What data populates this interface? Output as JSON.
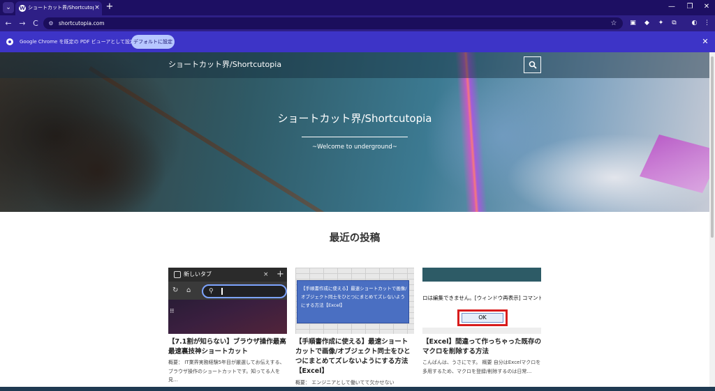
{
  "browser": {
    "tab_title": "ショートカット界/Shortcutopia | シ",
    "tab_close": "×",
    "new_tab": "+",
    "tab_menu": "⌄",
    "url": "shortcutopia.com",
    "window_controls": {
      "minimize": "—",
      "maximize": "❐",
      "close": "✕"
    },
    "nav": {
      "back": "←",
      "forward": "→",
      "reload": "C"
    },
    "infobar": {
      "message": "Google Chrome を既定の PDF ビューアとして設定する",
      "button": "デフォルトに設定",
      "close": "✕"
    }
  },
  "site": {
    "header_title": "ショートカット界/Shortcutopia",
    "hero_title": "ショートカット界/Shortcutopia",
    "hero_subtitle": "~Welcome to underground~",
    "section_title": "最近の投稿"
  },
  "posts": [
    {
      "title": "【7.1割が知らない】ブラウザ操作最高最速裏技神ショートカット",
      "excerpt": "概要： IT業界実務経験5年目が厳選してお伝えする、ブラウザ操作のショートカットです。知ってる人を見…",
      "thumb": {
        "tab_label": "新しいタブ",
        "tab_close": "×",
        "plus": "+"
      }
    },
    {
      "title": "【手順書作成に使える】最速ショートカットで画像/オブジェクト同士をひとつにまとめてズレないようにする方法【Excel】",
      "excerpt": "概要： エンジニアとして働いてて欠かせない",
      "thumb": {
        "popup_text": "【手順書作成に使える】最速ショートカットで画像/オブジェクト同士をひとつにまとめてズレないようにする方法【Excel】"
      }
    },
    {
      "title": "【Excel】間違って作っちゃった既存のマクロを削除する方法",
      "excerpt": "こんばんは、うさにです。 概要 自分はExcelマクロを多用するため、マクロを登録/削除するのは日常…",
      "thumb": {
        "message": "ロは編集できません。[ウィンドウ再表示] コマンドで",
        "ok_label": "OK"
      }
    }
  ],
  "colors": {
    "tabstrip": "#1d0f63",
    "toolbar": "#2e1f86",
    "infobar": "#3d34c7",
    "default_button": "#b7c6ff"
  }
}
